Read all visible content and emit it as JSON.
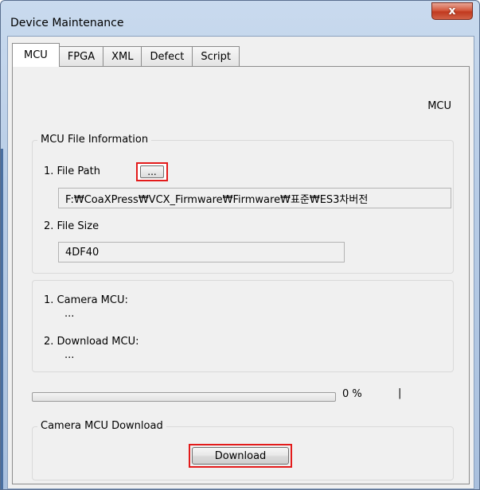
{
  "window": {
    "title": "Device Maintenance",
    "close_glyph": "x"
  },
  "tabs": [
    {
      "label": "MCU",
      "active": true
    },
    {
      "label": "FPGA",
      "active": false
    },
    {
      "label": "XML",
      "active": false
    },
    {
      "label": "Defect",
      "active": false
    },
    {
      "label": "Script",
      "active": false
    }
  ],
  "panel": {
    "header_label": "MCU",
    "file_info": {
      "legend": "MCU File Information",
      "file_path_label": "1. File Path",
      "browse_label": "...",
      "file_path_value": "F:₩CoaXPress₩VCX_Firmware₩Firmware₩표준₩ES3차버전",
      "file_size_label": "2. File Size",
      "file_size_value": "4DF40"
    },
    "versions": {
      "camera_mcu_label": "1. Camera MCU:",
      "camera_mcu_value": "...",
      "download_mcu_label": "2. Download MCU:",
      "download_mcu_value": "..."
    },
    "progress": {
      "value_percent": 0,
      "text": "0 %",
      "separator": "|"
    },
    "download": {
      "legend": "Camera MCU Download",
      "button_label": "Download"
    }
  },
  "colors": {
    "highlight": "#e31b1b",
    "progress_fill": "#36c030"
  },
  "icons": {
    "close": "close-icon"
  }
}
